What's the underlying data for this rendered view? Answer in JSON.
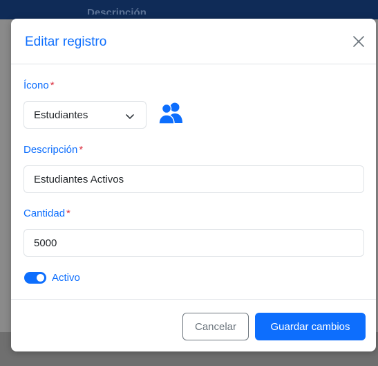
{
  "background": {
    "table_header": "Descripción"
  },
  "modal": {
    "title": "Editar registro",
    "close_icon": "close-icon",
    "fields": {
      "icono": {
        "label": "Ícono",
        "required_mark": "*",
        "selected": "Estudiantes",
        "preview_icon": "users-icon"
      },
      "descripcion": {
        "label": "Descripción",
        "required_mark": "*",
        "value": "Estudiantes Activos"
      },
      "cantidad": {
        "label": "Cantidad",
        "required_mark": "*",
        "value": "5000"
      },
      "activo": {
        "label": "Activo",
        "checked": true
      }
    },
    "footer": {
      "cancel_label": "Cancelar",
      "save_label": "Guardar cambios"
    }
  },
  "colors": {
    "accent": "#0d6efd",
    "required": "#dc3545",
    "overlay": "#8a8a8a"
  }
}
